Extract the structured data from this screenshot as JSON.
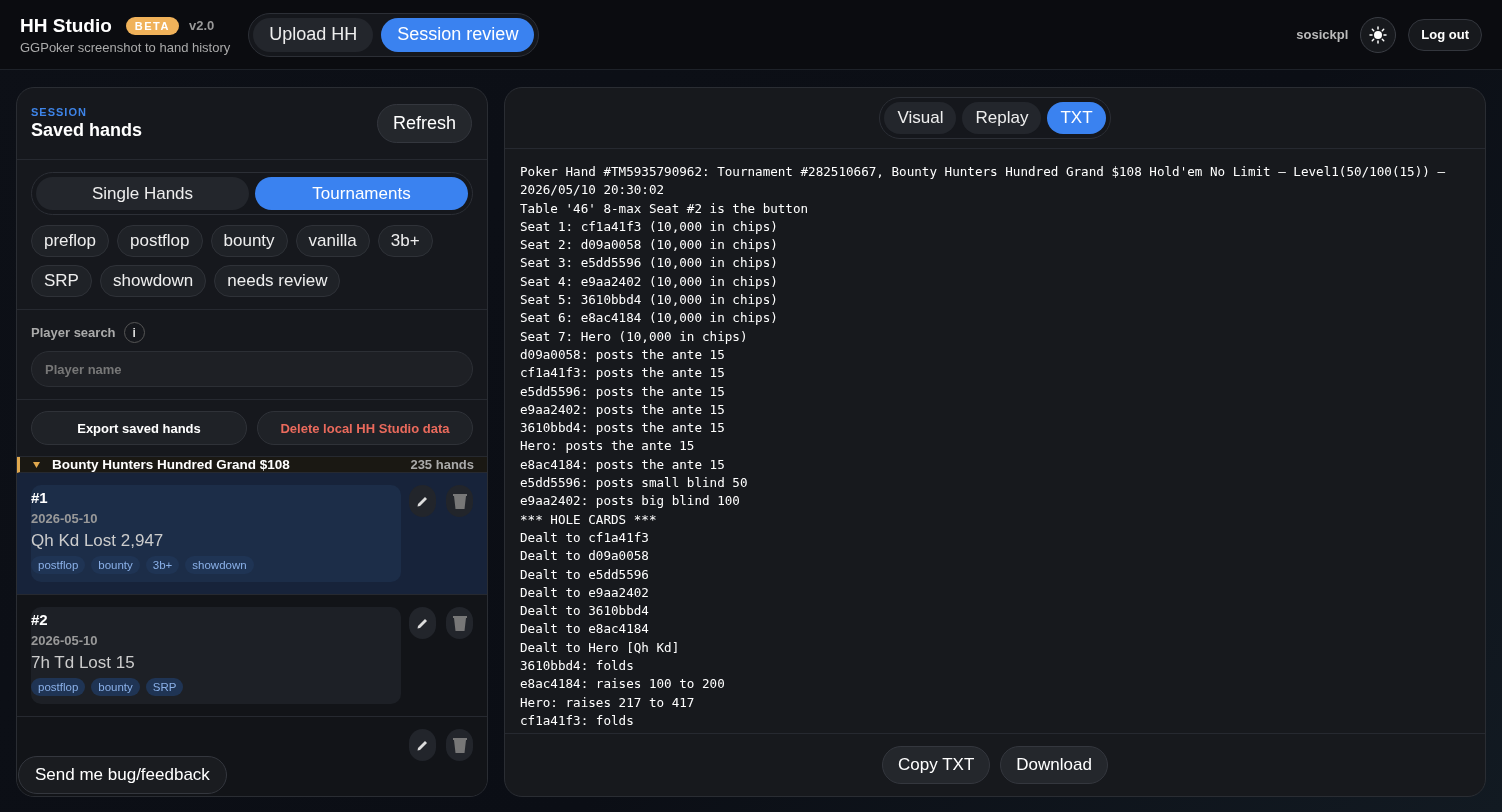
{
  "app": {
    "title": "HH Studio",
    "badge": "BETA",
    "version": "v2.0",
    "subtitle": "GGPoker screenshot to hand history"
  },
  "mode_tabs": [
    {
      "label": "Upload HH",
      "selected": false
    },
    {
      "label": "Session review",
      "selected": true
    }
  ],
  "user": {
    "name": "sosickpl",
    "logout": "Log out"
  },
  "session": {
    "eyebrow": "SESSION",
    "title": "Saved hands",
    "refresh": "Refresh",
    "view_tabs": [
      {
        "label": "Single Hands",
        "selected": false
      },
      {
        "label": "Tournaments",
        "selected": true
      }
    ],
    "filters": [
      "preflop",
      "postflop",
      "bounty",
      "vanilla",
      "3b+",
      "SRP",
      "showdown",
      "needs review"
    ],
    "search": {
      "label": "Player search",
      "info": "i",
      "placeholder": "Player name"
    },
    "export": "Export saved hands",
    "delete": "Delete local HH Studio data",
    "group": {
      "expanded": true,
      "name": "Bounty Hunters Hundred Grand $108",
      "count": "235 hands"
    },
    "hands": [
      {
        "number": "#1",
        "date": "2026-05-10",
        "summary": "Qh Kd Lost 2,947",
        "tags": [
          "postflop",
          "bounty",
          "3b+",
          "showdown"
        ],
        "selected": true
      },
      {
        "number": "#2",
        "date": "2026-05-10",
        "summary": "7h Td Lost 15",
        "tags": [
          "postflop",
          "bounty",
          "SRP"
        ],
        "selected": false
      }
    ],
    "feedback": "Send me bug/feedback"
  },
  "viewer": {
    "tabs": [
      {
        "label": "Visual",
        "selected": false
      },
      {
        "label": "Replay",
        "selected": false
      },
      {
        "label": "TXT",
        "selected": true
      }
    ],
    "lines": [
      "Poker Hand #TM5935790962: Tournament #282510667, Bounty Hunters Hundred Grand $108 Hold'em No Limit – Level1(50/100(15)) – 2026/05/10 20:30:02",
      "Table '46' 8-max Seat #2 is the button",
      "Seat 1: cf1a41f3 (10,000 in chips)",
      "Seat 2: d09a0058 (10,000 in chips)",
      "Seat 3: e5dd5596 (10,000 in chips)",
      "Seat 4: e9aa2402 (10,000 in chips)",
      "Seat 5: 3610bbd4 (10,000 in chips)",
      "Seat 6: e8ac4184 (10,000 in chips)",
      "Seat 7: Hero (10,000 in chips)",
      "d09a0058: posts the ante 15",
      "cf1a41f3: posts the ante 15",
      "e5dd5596: posts the ante 15",
      "e9aa2402: posts the ante 15",
      "3610bbd4: posts the ante 15",
      "Hero: posts the ante 15",
      "e8ac4184: posts the ante 15",
      "e5dd5596: posts small blind 50",
      "e9aa2402: posts big blind 100",
      "*** HOLE CARDS ***",
      "Dealt to cf1a41f3",
      "Dealt to d09a0058",
      "Dealt to e5dd5596",
      "Dealt to e9aa2402",
      "Dealt to 3610bbd4",
      "Dealt to e8ac4184",
      "Dealt to Hero [Qh Kd]",
      "3610bbd4: folds",
      "e8ac4184: raises 100 to 200",
      "Hero: raises 217 to 417",
      "cf1a41f3: folds"
    ],
    "copy": "Copy TXT",
    "download": "Download"
  }
}
